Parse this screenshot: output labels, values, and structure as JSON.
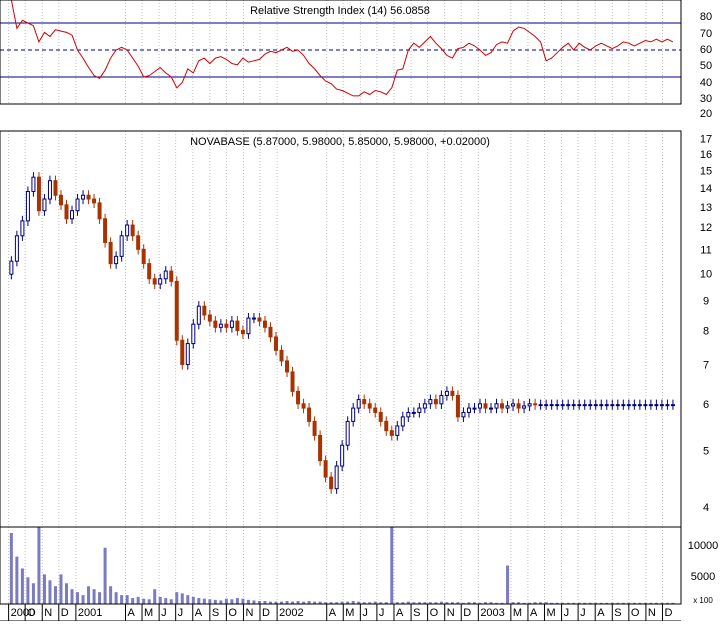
{
  "colors": {
    "background": "#ffffff",
    "grid": "#c0c0c0",
    "frame": "#000000",
    "rsi_line": "#d40000",
    "rsi_bands": "#000080",
    "candle_up": "#000080",
    "candle_down": "#a83200",
    "volume": "#7b7bbf"
  },
  "rsi_panel": {
    "title": "Relative Strength Index (14) 56.0858",
    "ticks": [
      "80",
      "70",
      "60",
      "50",
      "40",
      "30",
      "20"
    ]
  },
  "price_panel": {
    "title": "NOVABASE (5.87000, 5.98000, 5.85000, 5.98000, +0.02000)",
    "ticks": [
      "17",
      "16",
      "15",
      "14",
      "13",
      "12",
      "11",
      "10",
      "9",
      "8",
      "7",
      "6",
      "5",
      "4"
    ]
  },
  "volume_panel": {
    "ticks": [
      "10000",
      "5000"
    ],
    "unit_label": "x 100"
  },
  "x_axis": {
    "labels": [
      "2000",
      "O",
      "N",
      "D",
      "2001",
      "A",
      "M",
      "J",
      "J",
      "A",
      "S",
      "O",
      "N",
      "D",
      "2002",
      "A",
      "M",
      "J",
      "J",
      "A",
      "S",
      "O",
      "N",
      "D",
      "2003",
      "M",
      "A",
      "M",
      "J",
      "J",
      "A",
      "S",
      "O",
      "N",
      "D"
    ]
  },
  "chart_data": [
    {
      "type": "line",
      "panel": "rsi",
      "title": "Relative Strength Index (14) 56.0858",
      "ylim": [
        10,
        87
      ],
      "yticks": [
        80,
        70,
        60,
        50,
        40,
        30,
        20
      ],
      "reference_lines": [
        {
          "value": 70,
          "style": "solid"
        },
        {
          "value": 50,
          "style": "dashed"
        },
        {
          "value": 30,
          "style": "solid"
        }
      ],
      "x": [
        "2000-09-06",
        "2000-09-16",
        "2000-09-26",
        "2000-10-06",
        "2000-10-16",
        "2000-10-26",
        "2000-11-05",
        "2000-11-15",
        "2000-11-25",
        "2000-12-05",
        "2000-12-15",
        "2000-12-25",
        "2001-01-04",
        "2001-01-14",
        "2001-01-24",
        "2001-02-03",
        "2001-02-13",
        "2001-02-23",
        "2001-03-05",
        "2001-03-15",
        "2001-03-25",
        "2001-04-04",
        "2001-04-14",
        "2001-04-24",
        "2001-05-04",
        "2001-05-14",
        "2001-05-24",
        "2001-06-03",
        "2001-06-13",
        "2001-06-23",
        "2001-07-03",
        "2001-07-13",
        "2001-07-23",
        "2001-08-02",
        "2001-08-12",
        "2001-08-22",
        "2001-09-01",
        "2001-09-11",
        "2001-09-21",
        "2001-10-01",
        "2001-10-11",
        "2001-10-21",
        "2001-10-31",
        "2001-11-10",
        "2001-11-20",
        "2001-11-30",
        "2001-12-10",
        "2001-12-20",
        "2001-12-30",
        "2002-01-09",
        "2002-01-19",
        "2002-01-29",
        "2002-02-08",
        "2002-02-18",
        "2002-02-28",
        "2002-03-10",
        "2002-03-20",
        "2002-03-30",
        "2002-04-09",
        "2002-04-19",
        "2002-04-29",
        "2002-05-09",
        "2002-05-19",
        "2002-05-29",
        "2002-06-08",
        "2002-06-18",
        "2002-06-28",
        "2002-07-08",
        "2002-07-18",
        "2002-07-28",
        "2002-08-07",
        "2002-08-17",
        "2002-08-27",
        "2002-09-06",
        "2002-09-16",
        "2002-09-26",
        "2002-10-06",
        "2002-10-16",
        "2002-10-26",
        "2002-11-05",
        "2002-11-15",
        "2002-11-25",
        "2002-12-05",
        "2002-12-15",
        "2002-12-25",
        "2003-01-04",
        "2003-01-14",
        "2003-01-24",
        "2003-02-03",
        "2003-02-13",
        "2003-02-23",
        "2003-03-05",
        "2003-03-15",
        "2003-03-25",
        "2003-04-04",
        "2003-04-14",
        "2003-04-24",
        "2003-05-04",
        "2003-05-14",
        "2003-05-24",
        "2003-06-03",
        "2003-06-13",
        "2003-06-23",
        "2003-07-03",
        "2003-07-13",
        "2003-07-23",
        "2003-08-02",
        "2003-08-12",
        "2003-08-22",
        "2003-09-01",
        "2003-09-11",
        "2003-09-21",
        "2003-10-01",
        "2003-10-11",
        "2003-10-21",
        "2003-10-31",
        "2003-11-10",
        "2003-11-20",
        "2003-11-30",
        "2003-12-10",
        "2003-12-20"
      ],
      "y": [
        87,
        66,
        72,
        70,
        68,
        56,
        63,
        60,
        65,
        64,
        63,
        61,
        50,
        44,
        37,
        31,
        29,
        35,
        44,
        50,
        52,
        50,
        44,
        38,
        30,
        31,
        34,
        37,
        33,
        30,
        22,
        26,
        36,
        33,
        42,
        44,
        40,
        44,
        45,
        43,
        40,
        39,
        44,
        41,
        42,
        43,
        47,
        49,
        48,
        50,
        52,
        49,
        50,
        46,
        40,
        36,
        31,
        27,
        25,
        21,
        20,
        18,
        16,
        16,
        19,
        17,
        20,
        19,
        17,
        22,
        35,
        36,
        50,
        55,
        52,
        56,
        60,
        55,
        51,
        46,
        44,
        51,
        52,
        55,
        53,
        50,
        46,
        48,
        54,
        56,
        55,
        64,
        67,
        66,
        63,
        60,
        56,
        42,
        44,
        48,
        52,
        55,
        50,
        55,
        52,
        50,
        53,
        55,
        53,
        51,
        53,
        56,
        55,
        53,
        55,
        57,
        56,
        58,
        56,
        58,
        56
      ]
    },
    {
      "type": "candlestick",
      "panel": "price",
      "title": "NOVABASE (5.87000, 5.98000, 5.85000, 5.98000, +0.02000)",
      "scale": "log",
      "ylim": [
        3.7,
        17.5
      ],
      "yticks": [
        17,
        16,
        15,
        14,
        13,
        12,
        11,
        10,
        9,
        8,
        7,
        6,
        5,
        4
      ],
      "last": {
        "open": 5.87,
        "high": 5.98,
        "low": 5.85,
        "close": 5.98,
        "change": 0.02
      },
      "x": [
        "2000-09-06",
        "2000-09-16",
        "2000-09-26",
        "2000-10-06",
        "2000-10-16",
        "2000-10-26",
        "2000-11-05",
        "2000-11-15",
        "2000-11-25",
        "2000-12-05",
        "2000-12-15",
        "2000-12-25",
        "2001-01-04",
        "2001-01-14",
        "2001-01-24",
        "2001-02-03",
        "2001-02-13",
        "2001-02-23",
        "2001-03-05",
        "2001-03-15",
        "2001-03-25",
        "2001-04-04",
        "2001-04-14",
        "2001-04-24",
        "2001-05-04",
        "2001-05-14",
        "2001-05-24",
        "2001-06-03",
        "2001-06-13",
        "2001-06-23",
        "2001-07-03",
        "2001-07-13",
        "2001-07-23",
        "2001-08-02",
        "2001-08-12",
        "2001-08-22",
        "2001-09-01",
        "2001-09-11",
        "2001-09-21",
        "2001-10-01",
        "2001-10-11",
        "2001-10-21",
        "2001-10-31",
        "2001-11-10",
        "2001-11-20",
        "2001-11-30",
        "2001-12-10",
        "2001-12-20",
        "2001-12-30",
        "2002-01-09",
        "2002-01-19",
        "2002-01-29",
        "2002-02-08",
        "2002-02-18",
        "2002-02-28",
        "2002-03-10",
        "2002-03-20",
        "2002-03-30",
        "2002-04-09",
        "2002-04-19",
        "2002-04-29",
        "2002-05-09",
        "2002-05-19",
        "2002-05-29",
        "2002-06-08",
        "2002-06-18",
        "2002-06-28",
        "2002-07-08",
        "2002-07-18",
        "2002-07-28",
        "2002-08-07",
        "2002-08-17",
        "2002-08-27",
        "2002-09-06",
        "2002-09-16",
        "2002-09-26",
        "2002-10-06",
        "2002-10-16",
        "2002-10-26",
        "2002-11-05",
        "2002-11-15",
        "2002-11-25",
        "2002-12-05",
        "2002-12-15",
        "2002-12-25",
        "2003-01-04",
        "2003-01-14",
        "2003-01-24",
        "2003-02-03",
        "2003-02-13",
        "2003-02-23",
        "2003-03-05",
        "2003-03-15",
        "2003-03-25",
        "2003-04-04",
        "2003-04-14",
        "2003-04-24",
        "2003-05-04",
        "2003-05-14",
        "2003-05-24",
        "2003-06-03",
        "2003-06-13",
        "2003-06-23",
        "2003-07-03",
        "2003-07-13",
        "2003-07-23",
        "2003-08-02",
        "2003-08-12",
        "2003-08-22",
        "2003-09-01",
        "2003-09-11",
        "2003-09-21",
        "2003-10-01",
        "2003-10-11",
        "2003-10-21",
        "2003-10-31",
        "2003-11-10",
        "2003-11-20",
        "2003-11-30",
        "2003-12-10",
        "2003-12-20"
      ],
      "close": [
        10.5,
        11.6,
        12.3,
        13.8,
        14.6,
        12.8,
        13.4,
        14.4,
        13.6,
        13.1,
        12.4,
        12.8,
        13.4,
        13.6,
        13.4,
        13.2,
        12.4,
        11.3,
        10.4,
        10.7,
        11.6,
        12.1,
        11.6,
        11.0,
        10.4,
        9.8,
        9.6,
        9.8,
        10.1,
        9.7,
        7.7,
        7.0,
        7.6,
        8.2,
        8.8,
        8.5,
        8.3,
        8.1,
        8.2,
        8.1,
        8.3,
        8.0,
        7.9,
        8.4,
        8.4,
        8.3,
        8.1,
        7.8,
        7.4,
        7.1,
        6.8,
        6.3,
        6.0,
        5.9,
        5.6,
        5.3,
        4.8,
        4.5,
        4.3,
        4.7,
        5.1,
        5.6,
        5.9,
        6.1,
        6.0,
        5.9,
        5.8,
        5.6,
        5.4,
        5.3,
        5.5,
        5.7,
        5.8,
        5.8,
        5.9,
        6.0,
        6.1,
        6.0,
        6.2,
        6.3,
        6.2,
        5.7,
        5.8,
        5.9,
        5.9,
        6.0,
        5.9,
        5.9,
        6.0,
        5.9,
        5.95,
        6.0,
        5.9,
        5.95,
        6.0,
        5.98,
        5.98,
        5.98,
        5.98,
        5.98,
        5.98,
        5.98,
        5.98,
        5.98,
        5.98,
        5.98,
        5.98,
        5.98,
        5.98,
        5.98,
        5.98,
        5.98,
        5.98,
        5.98,
        5.98,
        5.98,
        5.98,
        5.98,
        5.98,
        5.98,
        5.98
      ]
    },
    {
      "type": "bar",
      "panel": "volume",
      "unit": "x 100",
      "ylim": [
        0,
        13000
      ],
      "yticks": [
        10000,
        5000
      ],
      "x": [
        "2000-09-06",
        "2000-09-16",
        "2000-09-26",
        "2000-10-06",
        "2000-10-16",
        "2000-10-26",
        "2000-11-05",
        "2000-11-15",
        "2000-11-25",
        "2000-12-05",
        "2000-12-15",
        "2000-12-25",
        "2001-01-04",
        "2001-01-14",
        "2001-01-24",
        "2001-02-03",
        "2001-02-13",
        "2001-02-23",
        "2001-03-05",
        "2001-03-15",
        "2001-03-25",
        "2001-04-04",
        "2001-04-14",
        "2001-04-24",
        "2001-05-04",
        "2001-05-14",
        "2001-05-24",
        "2001-06-03",
        "2001-06-13",
        "2001-06-23",
        "2001-07-03",
        "2001-07-13",
        "2001-07-23",
        "2001-08-02",
        "2001-08-12",
        "2001-08-22",
        "2001-09-01",
        "2001-09-11",
        "2001-09-21",
        "2001-10-01",
        "2001-10-11",
        "2001-10-21",
        "2001-10-31",
        "2001-11-10",
        "2001-11-20",
        "2001-11-30",
        "2001-12-10",
        "2001-12-20",
        "2001-12-30",
        "2002-01-09",
        "2002-01-19",
        "2002-01-29",
        "2002-02-08",
        "2002-02-18",
        "2002-02-28",
        "2002-03-10",
        "2002-03-20",
        "2002-03-30",
        "2002-04-09",
        "2002-04-19",
        "2002-04-29",
        "2002-05-09",
        "2002-05-19",
        "2002-05-29",
        "2002-06-08",
        "2002-06-18",
        "2002-06-28",
        "2002-07-08",
        "2002-07-18",
        "2002-07-28",
        "2002-08-07",
        "2002-08-17",
        "2002-08-27",
        "2002-09-06",
        "2002-09-16",
        "2002-09-26",
        "2002-10-06",
        "2002-10-16",
        "2002-10-26",
        "2002-11-05",
        "2002-11-15",
        "2002-11-25",
        "2002-12-05",
        "2002-12-15",
        "2002-12-25",
        "2003-01-04",
        "2003-01-14",
        "2003-01-24",
        "2003-02-03",
        "2003-02-13",
        "2003-02-23",
        "2003-03-05",
        "2003-03-15",
        "2003-03-25",
        "2003-04-04",
        "2003-04-14",
        "2003-04-24",
        "2003-05-04",
        "2003-05-14",
        "2003-05-24",
        "2003-06-03",
        "2003-06-13",
        "2003-06-23",
        "2003-07-03",
        "2003-07-13",
        "2003-07-23",
        "2003-08-02",
        "2003-08-12",
        "2003-08-22",
        "2003-09-01",
        "2003-09-11",
        "2003-09-21",
        "2003-10-01",
        "2003-10-11",
        "2003-10-21",
        "2003-10-31",
        "2003-11-10",
        "2003-11-20",
        "2003-11-30",
        "2003-12-10",
        "2003-12-20"
      ],
      "values": [
        12000,
        8000,
        6000,
        4500,
        3500,
        13000,
        5000,
        4000,
        3000,
        5000,
        3500,
        2500,
        2000,
        1500,
        3000,
        2500,
        2000,
        9500,
        3000,
        2000,
        1500,
        1500,
        1000,
        1200,
        900,
        800,
        2500,
        1200,
        1000,
        800,
        2000,
        1800,
        1500,
        1200,
        1000,
        900,
        800,
        700,
        600,
        900,
        800,
        1000,
        900,
        700,
        600,
        500,
        500,
        400,
        400,
        400,
        500,
        400,
        500,
        400,
        500,
        400,
        400,
        300,
        300,
        300,
        400,
        400,
        500,
        400,
        300,
        300,
        400,
        300,
        300,
        13000,
        300,
        300,
        400,
        300,
        300,
        300,
        300,
        300,
        400,
        300,
        300,
        300,
        200,
        300,
        300,
        200,
        300,
        300,
        200,
        200,
        6500,
        300,
        300,
        200,
        200,
        300,
        300,
        300,
        200,
        200,
        200,
        200,
        200,
        200,
        200,
        200,
        200,
        200,
        200,
        200,
        200,
        200,
        200,
        200,
        200,
        200,
        200,
        200,
        200,
        200,
        200
      ]
    }
  ]
}
